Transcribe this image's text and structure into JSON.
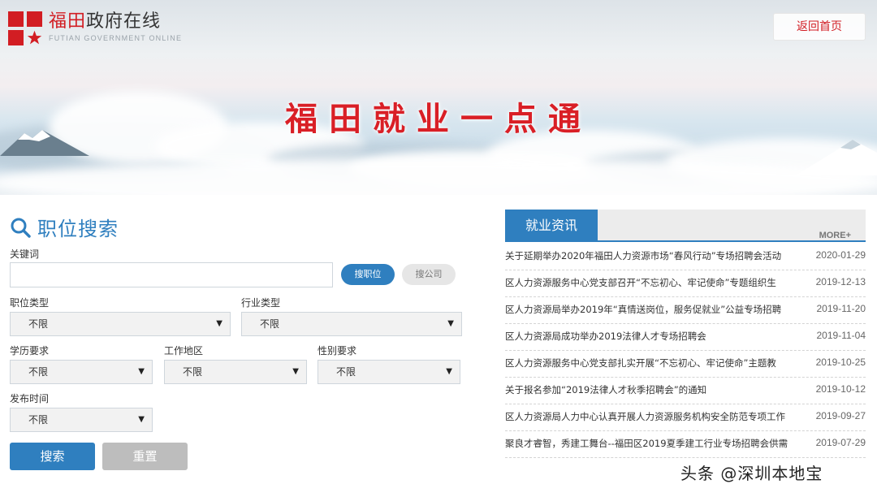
{
  "header": {
    "logo_cn_red": "福田",
    "logo_cn_gray": "政府在线",
    "logo_en": "FUTIAN GOVERNMENT ONLINE",
    "home_button": "返回首页",
    "banner_title": "福田就业一点通"
  },
  "search": {
    "title": "职位搜索",
    "keyword_label": "关键词",
    "keyword_value": "",
    "search_job_button": "搜职位",
    "search_company_button": "搜公司",
    "fields": {
      "job_type": {
        "label": "职位类型",
        "value": "不限"
      },
      "industry_type": {
        "label": "行业类型",
        "value": "不限"
      },
      "education": {
        "label": "学历要求",
        "value": "不限"
      },
      "work_area": {
        "label": "工作地区",
        "value": "不限"
      },
      "gender": {
        "label": "性别要求",
        "value": "不限"
      },
      "publish_time": {
        "label": "发布时间",
        "value": "不限"
      }
    },
    "submit_button": "搜索",
    "reset_button": "重置"
  },
  "news": {
    "tab": "就业资讯",
    "more": "MORE+",
    "items": [
      {
        "title": "关于延期举办2020年福田人力资源市场“春风行动”专场招聘会活动",
        "date": "2020-01-29"
      },
      {
        "title": "区人力资源服务中心党支部召开“不忘初心、牢记使命”专题组织生",
        "date": "2019-12-13"
      },
      {
        "title": "区人力资源局举办2019年“真情送岗位，服务促就业”公益专场招聘",
        "date": "2019-11-20"
      },
      {
        "title": "区人力资源局成功举办2019法律人才专场招聘会",
        "date": "2019-11-04"
      },
      {
        "title": "区人力资源服务中心党支部扎实开展“不忘初心、牢记使命”主题教",
        "date": "2019-10-25"
      },
      {
        "title": "关于报名参加“2019法律人才秋季招聘会”的通知",
        "date": "2019-10-12"
      },
      {
        "title": "区人力资源局人力中心认真开展人力资源服务机构安全防范专项工作",
        "date": "2019-09-27"
      },
      {
        "title": "聚良才睿智，秀建工舞台--福田区2019夏季建工行业专场招聘会供需",
        "date": "2019-07-29"
      }
    ]
  },
  "watermark": "头条 @深圳本地宝",
  "colors": {
    "brand_red": "#d21d23",
    "accent_blue": "#2f7fbf",
    "reset_gray": "#bdbdbd"
  }
}
